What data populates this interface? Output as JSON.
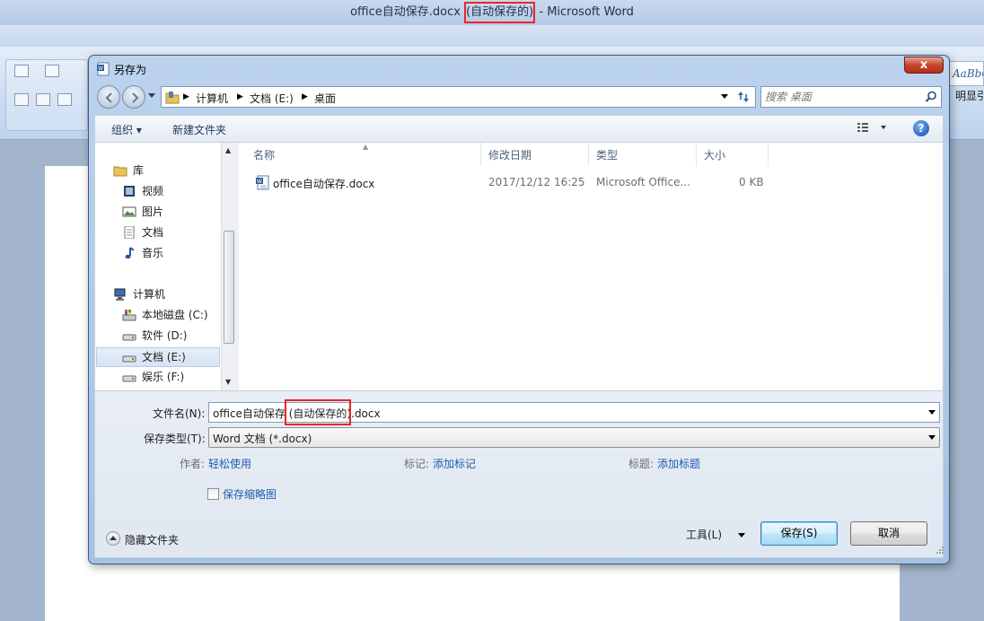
{
  "word": {
    "title_prefix": "office自动保存.docx ",
    "title_highlight": "(自动保存的)",
    "title_suffix": " - Microsoft Word",
    "style_sample": "AaBbC",
    "style_label": "明显引"
  },
  "dialog": {
    "title": "另存为",
    "close_glyph": "x",
    "breadcrumbs": [
      "计算机",
      "文档 (E:)",
      "桌面"
    ],
    "search_placeholder": "搜索 桌面",
    "toolbar": {
      "organize": "组织 ▾",
      "new_folder": "新建文件夹",
      "help": "?"
    },
    "nav_tree": [
      {
        "label": "库",
        "icon": "library-icon",
        "level": 0
      },
      {
        "label": "视频",
        "icon": "video-icon",
        "level": 1
      },
      {
        "label": "图片",
        "icon": "picture-icon",
        "level": 1
      },
      {
        "label": "文档",
        "icon": "document-icon",
        "level": 1
      },
      {
        "label": "音乐",
        "icon": "music-icon",
        "level": 1
      },
      {
        "label": "计算机",
        "icon": "computer-icon",
        "level": 0
      },
      {
        "label": "本地磁盘 (C:)",
        "icon": "system-drive-icon",
        "level": 1
      },
      {
        "label": "软件 (D:)",
        "icon": "drive-icon",
        "level": 1
      },
      {
        "label": "文档 (E:)",
        "icon": "drive-icon",
        "level": 1,
        "selected": true
      },
      {
        "label": "娱乐 (F:)",
        "icon": "drive-icon",
        "level": 1
      }
    ],
    "columns": [
      "名称",
      "修改日期",
      "类型",
      "大小"
    ],
    "files": [
      {
        "name": "office自动保存.docx",
        "modified": "2017/12/12 16:25",
        "type": "Microsoft Office...",
        "size": "0 KB"
      }
    ],
    "filename_label": "文件名(N):",
    "filename_prefix": "office自动保存 ",
    "filename_highlight": "(自动保存的)",
    "filename_suffix": ".docx",
    "filetype_label": "保存类型(T):",
    "filetype_value": "Word 文档 (*.docx)",
    "meta": {
      "author_label": "作者:",
      "author_value": "轻松使用",
      "tags_label": "标记:",
      "tags_value": "添加标记",
      "title_label": "标题:",
      "title_value": "添加标题"
    },
    "thumbnail_label": "保存缩略图",
    "hide_folders": "隐藏文件夹",
    "tools": "工具(L)",
    "save": "保存(S)",
    "cancel": "取消"
  },
  "colors": {
    "highlight": "#e8262c",
    "link": "#1f5bb0",
    "dialog_frame": "#bcd3ee"
  }
}
